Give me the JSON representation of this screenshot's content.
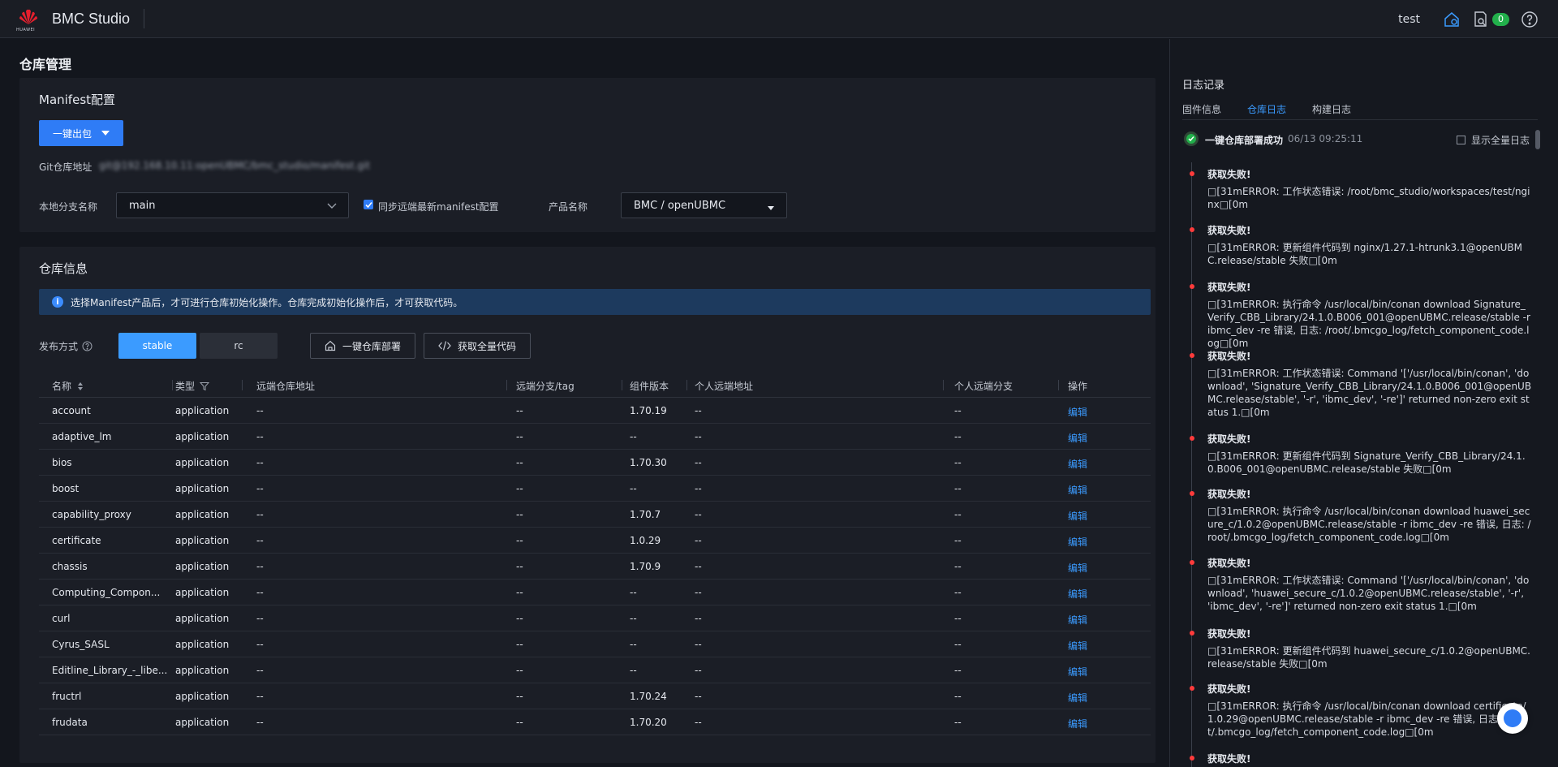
{
  "header": {
    "brand_text": "HUAWEI",
    "app_title": "BMC Studio",
    "user": "test",
    "badge_count": "0"
  },
  "page": {
    "title": "仓库管理"
  },
  "manifest": {
    "title": "Manifest配置",
    "pack_button": "一键出包",
    "git_label": "Git仓库地址",
    "git_value": "git@192.168.10.11:openUBMC/bmc_studio/manifest.git",
    "branch_label": "本地分支名称",
    "branch_value": "main",
    "sync_label": "同步远端最新manifest配置",
    "product_label": "产品名称",
    "product_value": "BMC / openUBMC"
  },
  "repo": {
    "title": "仓库信息",
    "info": "选择Manifest产品后，才可进行仓库初始化操作。仓库完成初始化操作后，才可获取代码。",
    "release_label": "发布方式",
    "seg_stable": "stable",
    "seg_rc": "rc",
    "deploy_button": "一键仓库部署",
    "fetch_button": "获取全量代码",
    "columns": [
      "名称",
      "类型",
      "远端仓库地址",
      "远端分支/tag",
      "组件版本",
      "个人远端地址",
      "个人远端分支",
      "操作"
    ],
    "rows": [
      {
        "name": "account",
        "type": "application",
        "remote": "--",
        "branch": "--",
        "version": "1.70.19",
        "personal": "--",
        "pbranch": "--",
        "op": "编辑"
      },
      {
        "name": "adaptive_lm",
        "type": "application",
        "remote": "--",
        "branch": "--",
        "version": "--",
        "personal": "--",
        "pbranch": "--",
        "op": "编辑"
      },
      {
        "name": "bios",
        "type": "application",
        "remote": "--",
        "branch": "--",
        "version": "1.70.30",
        "personal": "--",
        "pbranch": "--",
        "op": "编辑"
      },
      {
        "name": "boost",
        "type": "application",
        "remote": "--",
        "branch": "--",
        "version": "--",
        "personal": "--",
        "pbranch": "--",
        "op": "编辑"
      },
      {
        "name": "capability_proxy",
        "type": "application",
        "remote": "--",
        "branch": "--",
        "version": "1.70.7",
        "personal": "--",
        "pbranch": "--",
        "op": "编辑"
      },
      {
        "name": "certificate",
        "type": "application",
        "remote": "--",
        "branch": "--",
        "version": "1.0.29",
        "personal": "--",
        "pbranch": "--",
        "op": "编辑"
      },
      {
        "name": "chassis",
        "type": "application",
        "remote": "--",
        "branch": "--",
        "version": "1.70.9",
        "personal": "--",
        "pbranch": "--",
        "op": "编辑"
      },
      {
        "name": "Computing_Compon...",
        "type": "application",
        "remote": "--",
        "branch": "--",
        "version": "--",
        "personal": "--",
        "pbranch": "--",
        "op": "编辑"
      },
      {
        "name": "curl",
        "type": "application",
        "remote": "--",
        "branch": "--",
        "version": "--",
        "personal": "--",
        "pbranch": "--",
        "op": "编辑"
      },
      {
        "name": "Cyrus_SASL",
        "type": "application",
        "remote": "--",
        "branch": "--",
        "version": "--",
        "personal": "--",
        "pbranch": "--",
        "op": "编辑"
      },
      {
        "name": "Editline_Library_-_libe...",
        "type": "application",
        "remote": "--",
        "branch": "--",
        "version": "--",
        "personal": "--",
        "pbranch": "--",
        "op": "编辑"
      },
      {
        "name": "fructrl",
        "type": "application",
        "remote": "--",
        "branch": "--",
        "version": "1.70.24",
        "personal": "--",
        "pbranch": "--",
        "op": "编辑"
      },
      {
        "name": "frudata",
        "type": "application",
        "remote": "--",
        "branch": "--",
        "version": "1.70.20",
        "personal": "--",
        "pbranch": "--",
        "op": "编辑"
      }
    ]
  },
  "logs": {
    "title": "日志记录",
    "tabs": [
      "固件信息",
      "仓库日志",
      "构建日志"
    ],
    "active_tab": 1,
    "head_text": "一键仓库部署成功",
    "head_time": "06/13 09:25:11",
    "show_all": "显示全量日志",
    "items": [
      {
        "title": "获取失败!",
        "msg": "\u0000[31mERROR: 工作状态错误: /root/bmc_studio/workspaces/test/nginx\u0000[0m"
      },
      {
        "title": "获取失败!",
        "msg": "\u0000[31mERROR: 更新组件代码到 nginx/1.27.1-htrunk3.1@openUBMC.release/stable 失败\u0000[0m"
      },
      {
        "title": "获取失败!",
        "msg": "\u0000[31mERROR: 执行命令 /usr/local/bin/conan download Signature_Verify_CBB_Library/24.1.0.B006_001@openUBMC.release/stable -r ibmc_dev -re 错误, 日志: /root/.bmcgo_log/fetch_component_code.log\u0000[0m"
      },
      {
        "title": "获取失败!",
        "msg": "\u0000[31mERROR: 工作状态错误: Command '['/usr/local/bin/conan', 'download', 'Signature_Verify_CBB_Library/24.1.0.B006_001@openUBMC.release/stable', '-r', 'ibmc_dev', '-re']' returned non-zero exit status 1.\u0000[0m"
      },
      {
        "title": "获取失败!",
        "msg": "\u0000[31mERROR: 更新组件代码到 Signature_Verify_CBB_Library/24.1.0.B006_001@openUBMC.release/stable 失败\u0000[0m"
      },
      {
        "title": "获取失败!",
        "msg": "\u0000[31mERROR: 执行命令 /usr/local/bin/conan download huawei_secure_c/1.0.2@openUBMC.release/stable -r ibmc_dev -re 错误, 日志: /root/.bmcgo_log/fetch_component_code.log\u0000[0m"
      },
      {
        "title": "获取失败!",
        "msg": "\u0000[31mERROR: 工作状态错误: Command '['/usr/local/bin/conan', 'download', 'huawei_secure_c/1.0.2@openUBMC.release/stable', '-r', 'ibmc_dev', '-re']' returned non-zero exit status 1.\u0000[0m"
      },
      {
        "title": "获取失败!",
        "msg": "\u0000[31mERROR: 更新组件代码到 huawei_secure_c/1.0.2@openUBMC.release/stable 失败\u0000[0m"
      },
      {
        "title": "获取失败!",
        "msg": "\u0000[31mERROR: 执行命令 /usr/local/bin/conan download certificate/1.0.29@openUBMC.release/stable -r ibmc_dev -re 错误, 日志: /root/.bmcgo_log/fetch_component_code.log\u0000[0m"
      },
      {
        "title": "获取失败!",
        "msg": ""
      }
    ]
  }
}
